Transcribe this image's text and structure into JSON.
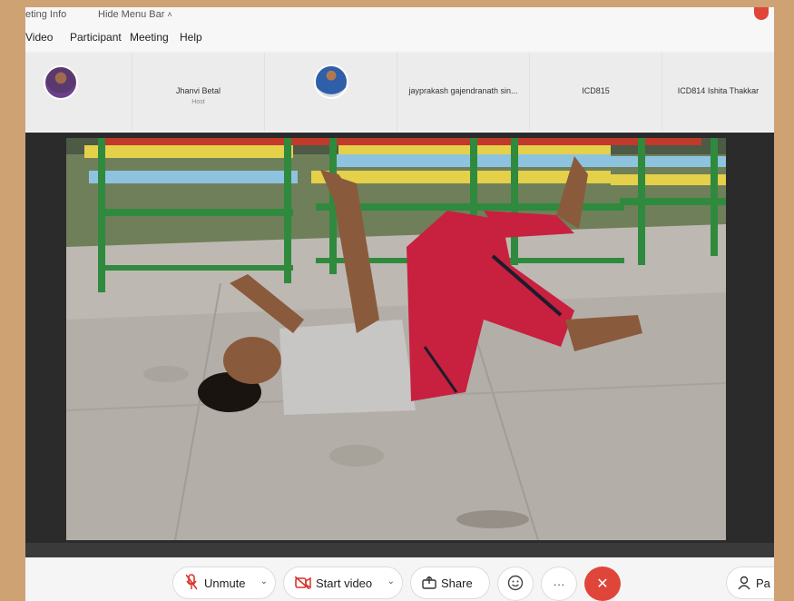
{
  "titlebar": {
    "meeting_info_label": "eting Info",
    "hide_menu_label": "Hide Menu Bar"
  },
  "menubar": {
    "items": [
      "Video",
      "Participant",
      "Meeting",
      "Help"
    ]
  },
  "participants": [
    {
      "name": "",
      "role": ""
    },
    {
      "name": "Jhanvi Betal",
      "role": "Host"
    },
    {
      "name": "",
      "role": ""
    },
    {
      "name": "jayprakash gajendranath sin...",
      "role": ""
    },
    {
      "name": "ICD815",
      "role": ""
    },
    {
      "name": "ICD814 Ishita Thakkar",
      "role": ""
    }
  ],
  "toolbar": {
    "unmute_label": "Unmute",
    "start_video_label": "Start video",
    "share_label": "Share",
    "more_label": "···",
    "end_label": "✕",
    "participants_label": "Pa"
  },
  "colors": {
    "end_button": "#e0453a",
    "unmute_icon": "#d9342b",
    "video_icon": "#d9342b"
  },
  "icons": {
    "mic_muted": "mic-muted-icon",
    "video_off": "video-off-icon",
    "share": "share-icon",
    "reactions": "smiley-icon",
    "more": "more-icon",
    "end": "close-icon",
    "participants": "person-icon"
  }
}
